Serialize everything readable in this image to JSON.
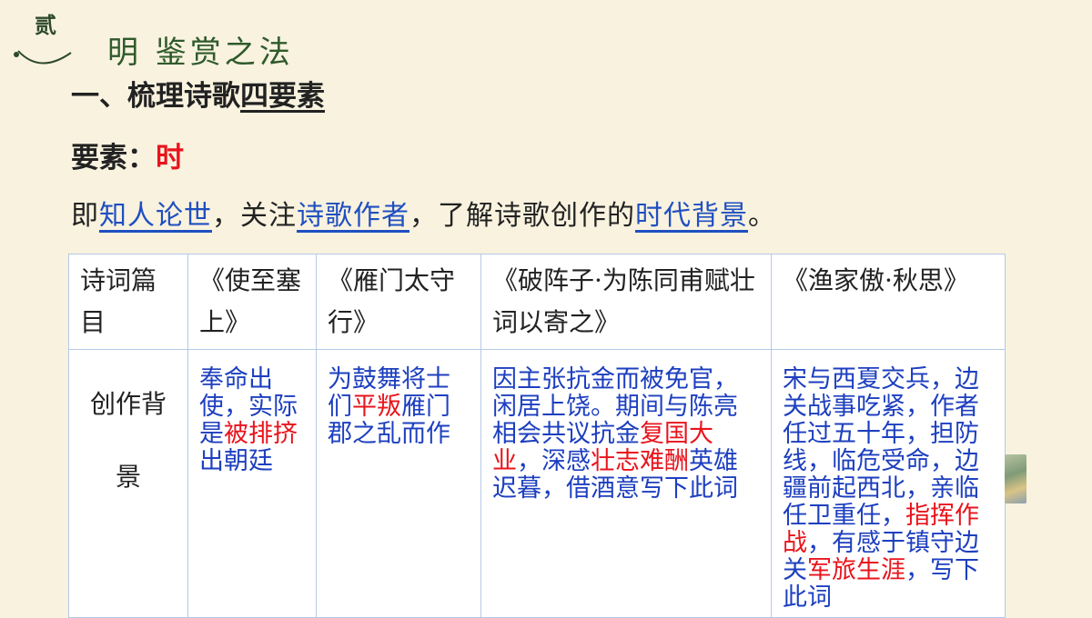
{
  "section": {
    "badge": "贰",
    "title": "明 鉴赏之法"
  },
  "heading": {
    "prefix": "一、梳理诗歌",
    "underlined": "四要素"
  },
  "element": {
    "label": "要素：",
    "value": "时"
  },
  "intro": {
    "p1": "即",
    "l1": "知人论世",
    "p2": "，关注",
    "l2": "诗歌作者",
    "p3": "，了解诗歌创作的",
    "l3": "时代背景",
    "p4": "。"
  },
  "table": {
    "header": [
      "诗词篇目",
      "《使至塞上》",
      "《雁门太守行》",
      "《破阵子·为陈同甫赋壮词以寄之》",
      "《渔家傲·秋思》"
    ],
    "row_label": "创作背景",
    "cells": [
      {
        "a": "奉命出使，实际是",
        "b": "被排挤",
        "c": "出朝廷"
      },
      {
        "a": "为鼓舞将士们",
        "b": "平叛",
        "c": "雁门郡之乱而作"
      },
      {
        "a": "因主张抗金而被免官，闲居上饶。期间与陈亮相会共议抗金",
        "b": "复国大业",
        "c": "，深感",
        "d": "壮志难酬",
        "e": "英雄迟暮，借酒意写下此词"
      },
      {
        "a": "宋与西夏交兵，边关战事吃紧，作者任过五十年，担防线，临危受命，边疆前起西北，亲临任卫重任，",
        "b": "指挥作战",
        "c": "，有感于镇守边关",
        "d": "军旅生涯",
        "e": "，写下此词"
      }
    ]
  }
}
